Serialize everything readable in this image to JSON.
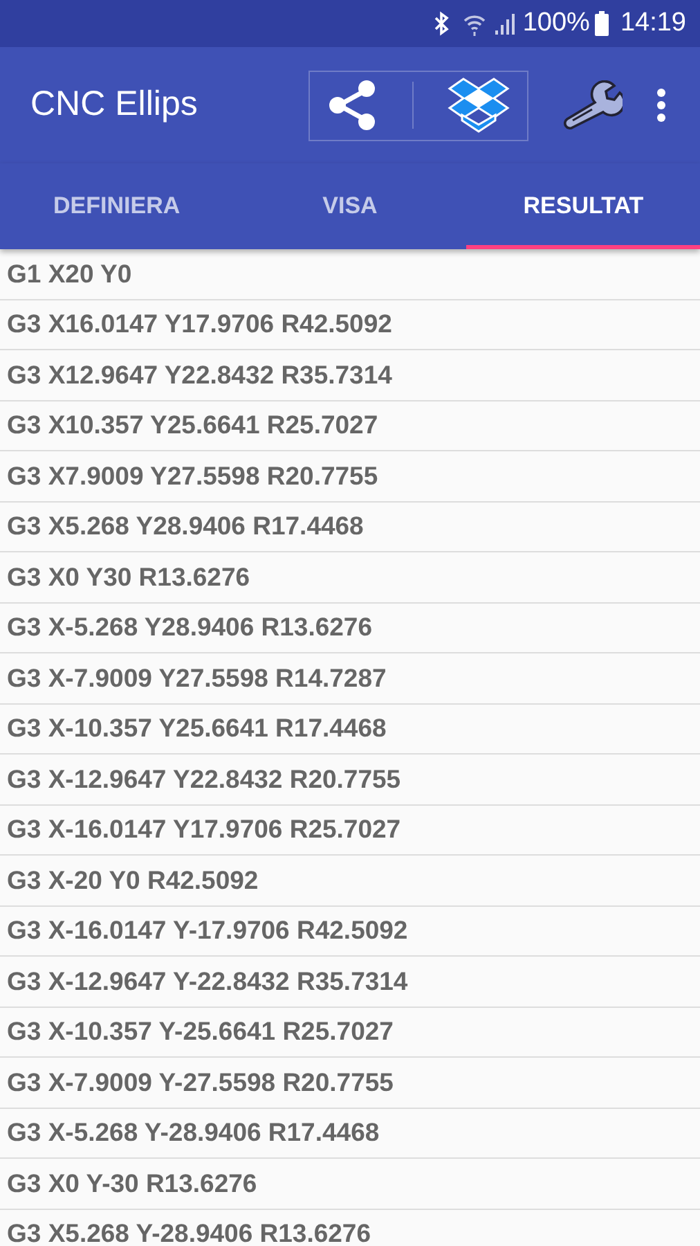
{
  "status_bar": {
    "battery": "100%",
    "time": "14:19"
  },
  "app_bar": {
    "title": "CNC Ellips"
  },
  "tabs": [
    {
      "label": "DEFINIERA",
      "selected": false
    },
    {
      "label": "VISA",
      "selected": false
    },
    {
      "label": "RESULTAT",
      "selected": true
    }
  ],
  "lines": [
    "G1 X20 Y0",
    "G3 X16.0147 Y17.9706 R42.5092",
    "G3 X12.9647 Y22.8432 R35.7314",
    "G3 X10.357 Y25.6641 R25.7027",
    "G3 X7.9009 Y27.5598 R20.7755",
    "G3 X5.268 Y28.9406 R17.4468",
    "G3 X0 Y30 R13.6276",
    "G3 X-5.268 Y28.9406 R13.6276",
    "G3 X-7.9009 Y27.5598 R14.7287",
    "G3 X-10.357 Y25.6641 R17.4468",
    "G3 X-12.9647 Y22.8432 R20.7755",
    "G3 X-16.0147 Y17.9706 R25.7027",
    "G3 X-20 Y0 R42.5092",
    "G3 X-16.0147 Y-17.9706 R42.5092",
    "G3 X-12.9647 Y-22.8432 R35.7314",
    "G3 X-10.357 Y-25.6641 R25.7027",
    "G3 X-7.9009 Y-27.5598 R20.7755",
    "G3 X-5.268 Y-28.9406 R17.4468",
    "G3 X0 Y-30 R13.6276",
    "G3 X5.268 Y-28.9406 R13.6276"
  ]
}
